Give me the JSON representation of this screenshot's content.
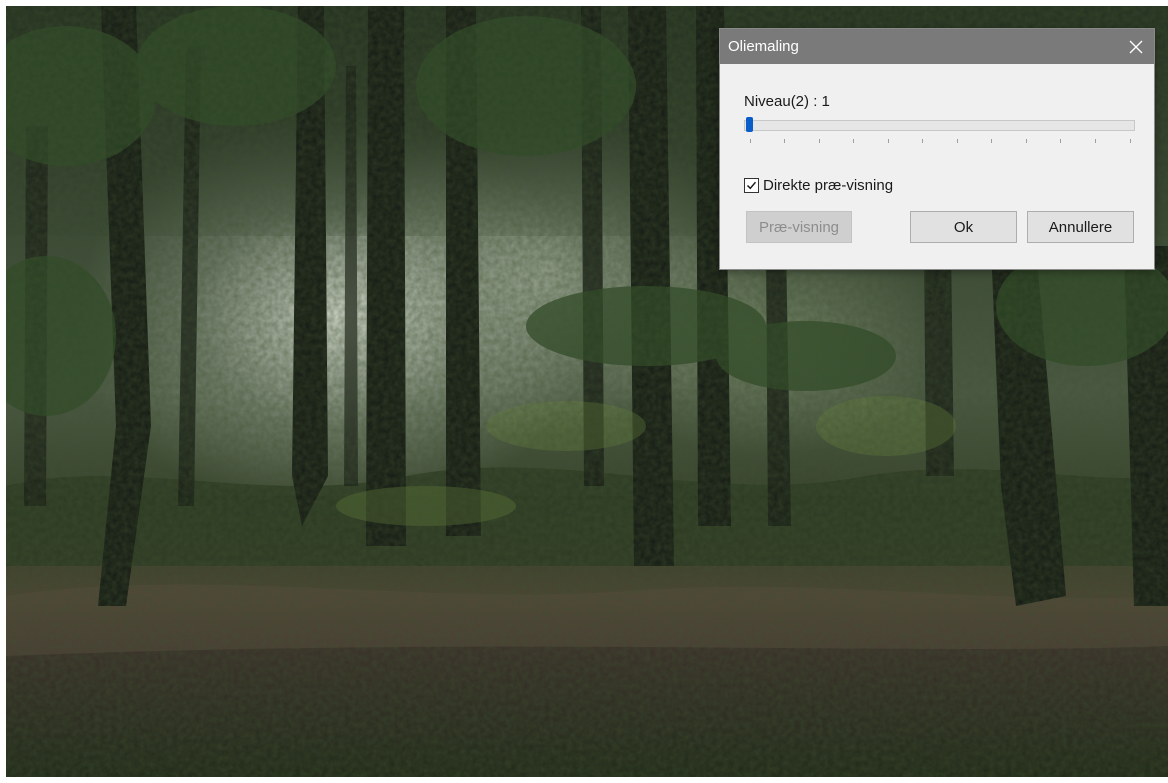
{
  "dialog": {
    "title": "Oliemaling",
    "close_icon": "close-icon",
    "level_label": "Niveau(2) : 1",
    "level": {
      "value": 1,
      "min": 1,
      "max": 12,
      "ticks": 12
    },
    "live_preview": {
      "label": "Direkte præ-visning",
      "checked": true
    },
    "buttons": {
      "preview": "Præ-visning",
      "ok": "Ok",
      "cancel": "Annullere"
    }
  },
  "colors": {
    "titlebar": "#7a7a7a",
    "dialog_bg": "#f0f0f0",
    "slider_thumb": "#0a5dc9"
  }
}
